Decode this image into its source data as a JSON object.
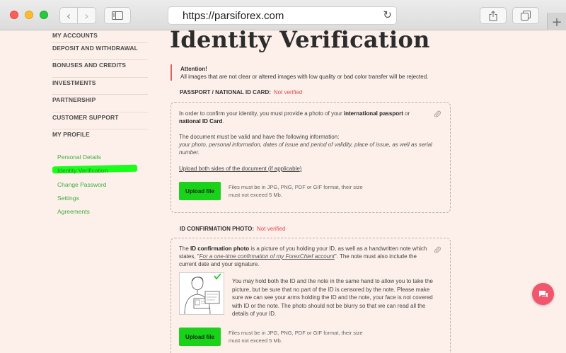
{
  "browser": {
    "url": "https://parsiforex.com",
    "back_icon": "‹",
    "forward_icon": "›",
    "reload_icon": "↻",
    "new_tab_icon": "+"
  },
  "leftnav": {
    "items": [
      {
        "label": "MY ACCOUNTS"
      },
      {
        "label": "DEPOSIT AND WITHDRAWAL"
      },
      {
        "label": "BONUSES AND CREDITS"
      },
      {
        "label": "INVESTMENTS"
      },
      {
        "label": "PARTNERSHIP"
      },
      {
        "label": "CUSTOMER SUPPORT"
      },
      {
        "label": "MY PROFILE"
      }
    ],
    "subitems": [
      {
        "label": "Personal Details"
      },
      {
        "label": "Identity Verification",
        "active": true
      },
      {
        "label": "Change Password"
      },
      {
        "label": "Settings"
      },
      {
        "label": "Agreements"
      }
    ]
  },
  "main": {
    "title": "Identity Verification",
    "attention_title": "Attention!",
    "attention_text": "All images that are not clear or altered images with low quality or bad color transfer will be rejected.",
    "passport": {
      "label": "PASSPORT / NATIONAL ID CARD:",
      "status": "Not verified",
      "intro_1": "In order to confirm your identity, you must provide a photo of your ",
      "intro_bold_1": "international passport",
      "intro_2": " or ",
      "intro_bold_2": "national ID Card",
      "intro_3": ".",
      "valid_text": "The document must be valid and have the following information:",
      "valid_italic": "your photo, personal information, dates of issue and period of validity, place of issue, as well as serial number.",
      "upload_sides_1": "Upload both sides of the document (",
      "upload_sides_link": "if applicable",
      "upload_sides_2": ")",
      "upload_button": "Upload file",
      "upload_note": "Files must be in JPG, PNG, PDF or GIF format, their size must not exceed 5 Mb."
    },
    "id_photo": {
      "label": "ID CONFIRMATION PHOTO:",
      "status": "Not verified",
      "intro_1": "The ",
      "intro_bold": "ID confirmation photo",
      "intro_2": " is a picture of you holding your ID, as well as a handwritten note which states, \"",
      "intro_italic": "For a one-time confirmation of my ForexChief account",
      "intro_3": "\". The note must also include the current date and your signature.",
      "hold_text": "You may hold both the ID and the note in the same hand to allow you to take the picture, but be sure that no part of the ID is censored by the note. Please make sure we can see your arms holding the ID and the note, your face is not covered with ID or the note. The photo should not be blurry so that we can read all the details of your ID.",
      "upload_button": "Upload file",
      "upload_note": "Files must be in JPG, PNG, PDF or GIF format, their size must not exceed 5 Mb."
    }
  },
  "colors": {
    "page_bg": "#fdf0ea",
    "accent_green": "#19d219",
    "link_green": "#3fae3f",
    "status_red": "#e04848",
    "chat_button": "#f2566d",
    "highlight": "#19ff19"
  },
  "icons": [
    "sidebar-toggle-icon",
    "share-icon",
    "tabs-icon",
    "paperclip-icon",
    "chat-icon",
    "reload-icon"
  ]
}
